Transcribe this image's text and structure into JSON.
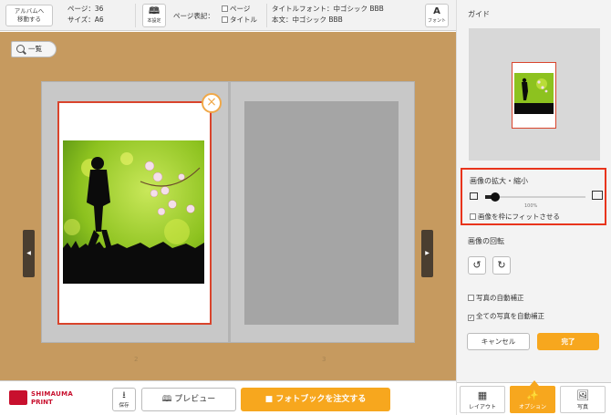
{
  "topbar": {
    "back_line1": "アルバムへ",
    "back_line2": "移動する",
    "pages": "ページ：36",
    "size": "サイズ：A6",
    "book_settings_label": "本設定",
    "page_display_label": "ページ表記：",
    "check_page_label": "ページ",
    "check_title_label": "タイトル",
    "title_font": "タイトルフォント：中ゴシック BBB",
    "body_font": "本文：中ゴシック BBB",
    "font_btn_glyph": "A",
    "font_btn_label": "フォント"
  },
  "workspace": {
    "zoom_btn_label": "一覧",
    "left_page_number": "2",
    "right_page_number": "3",
    "close_glyph": "×",
    "prev_glyph": "◀",
    "next_glyph": "▶",
    "photo_colors": {
      "bg": "#8dc21f",
      "bg_light": "#c9e85a",
      "silhouette": "#0b0b0b",
      "blossom": "#f2d7e6"
    }
  },
  "bottombar": {
    "logo_line1": "SHIMAUMA",
    "logo_line2": "PRINT",
    "save_label": "保存",
    "preview_label": "プレビュー",
    "order_label": "フォトブックを注文する"
  },
  "panel": {
    "guide_title": "ガイド",
    "zoom": {
      "title": "画像の拡大・縮小",
      "percent_text": "100%",
      "slider_value_fraction": 0.1,
      "fit_label": "画像を枠にフィットさせる"
    },
    "rotation_title": "画像の回転",
    "rotate_left_glyph": "↺",
    "rotate_right_glyph": "↻",
    "auto_correct_label": "写真の自動補正",
    "auto_correct_all_label": "全ての写真を自動補正",
    "cancel_label": "キャンセル",
    "done_label": "完了",
    "tabs": [
      {
        "label": "レイアウト",
        "icon": "layout-icon",
        "active": false
      },
      {
        "label": "オプション",
        "icon": "wand-icon",
        "active": true
      },
      {
        "label": "写真",
        "icon": "photo-icon",
        "active": false
      }
    ]
  },
  "colors": {
    "accent": "#f7a71e",
    "highlight_frame": "#e8341c",
    "page_frame": "#d9442c",
    "wood": "#c69a5f"
  }
}
